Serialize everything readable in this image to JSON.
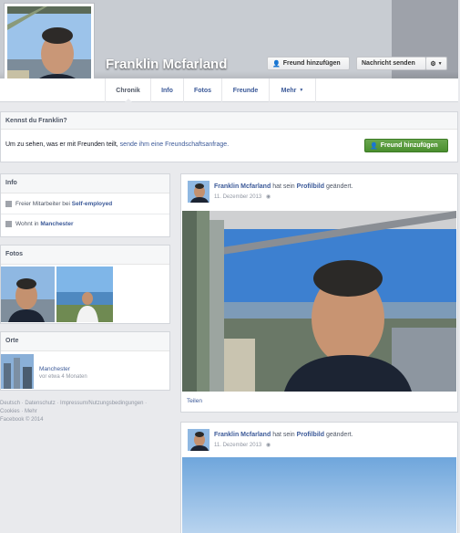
{
  "profile": {
    "name": "Franklin Mcfarland",
    "add_friend": "Freund hinzufügen",
    "message": "Nachricht senden"
  },
  "tabs": [
    "Chronik",
    "Info",
    "Fotos",
    "Freunde",
    "Mehr"
  ],
  "know": {
    "title": "Kennst du Franklin?",
    "text": "Um zu sehen, was er mit Freunden teilt,",
    "link": "sende ihm eine Freundschaftsanfrage.",
    "add_friend": "Freund hinzufügen"
  },
  "info": {
    "title": "Info",
    "work_prefix": "Freier Mitarbeiter bei",
    "work": "Self-employed",
    "lives_prefix": "Wohnt in",
    "lives": "Manchester"
  },
  "photos": {
    "title": "Fotos"
  },
  "places": {
    "title": "Orte",
    "place": "Manchester",
    "time": "vor etwa 4 Monaten"
  },
  "footer": {
    "line1": "Deutsch · Datenschutz · Impressum/Nutzungsbedingungen ·",
    "line2": "Cookies · Mehr",
    "line3": "Facebook © 2014"
  },
  "posts": [
    {
      "author": "Franklin Mcfarland",
      "mid": "hat sein",
      "obj": "Profilbild",
      "action": "geändert.",
      "date": "11. Dezember 2013",
      "share": "Teilen"
    },
    {
      "author": "Franklin Mcfarland",
      "mid": "hat sein",
      "obj": "Profilbild",
      "action": "geändert.",
      "date": "11. Dezember 2013"
    }
  ]
}
